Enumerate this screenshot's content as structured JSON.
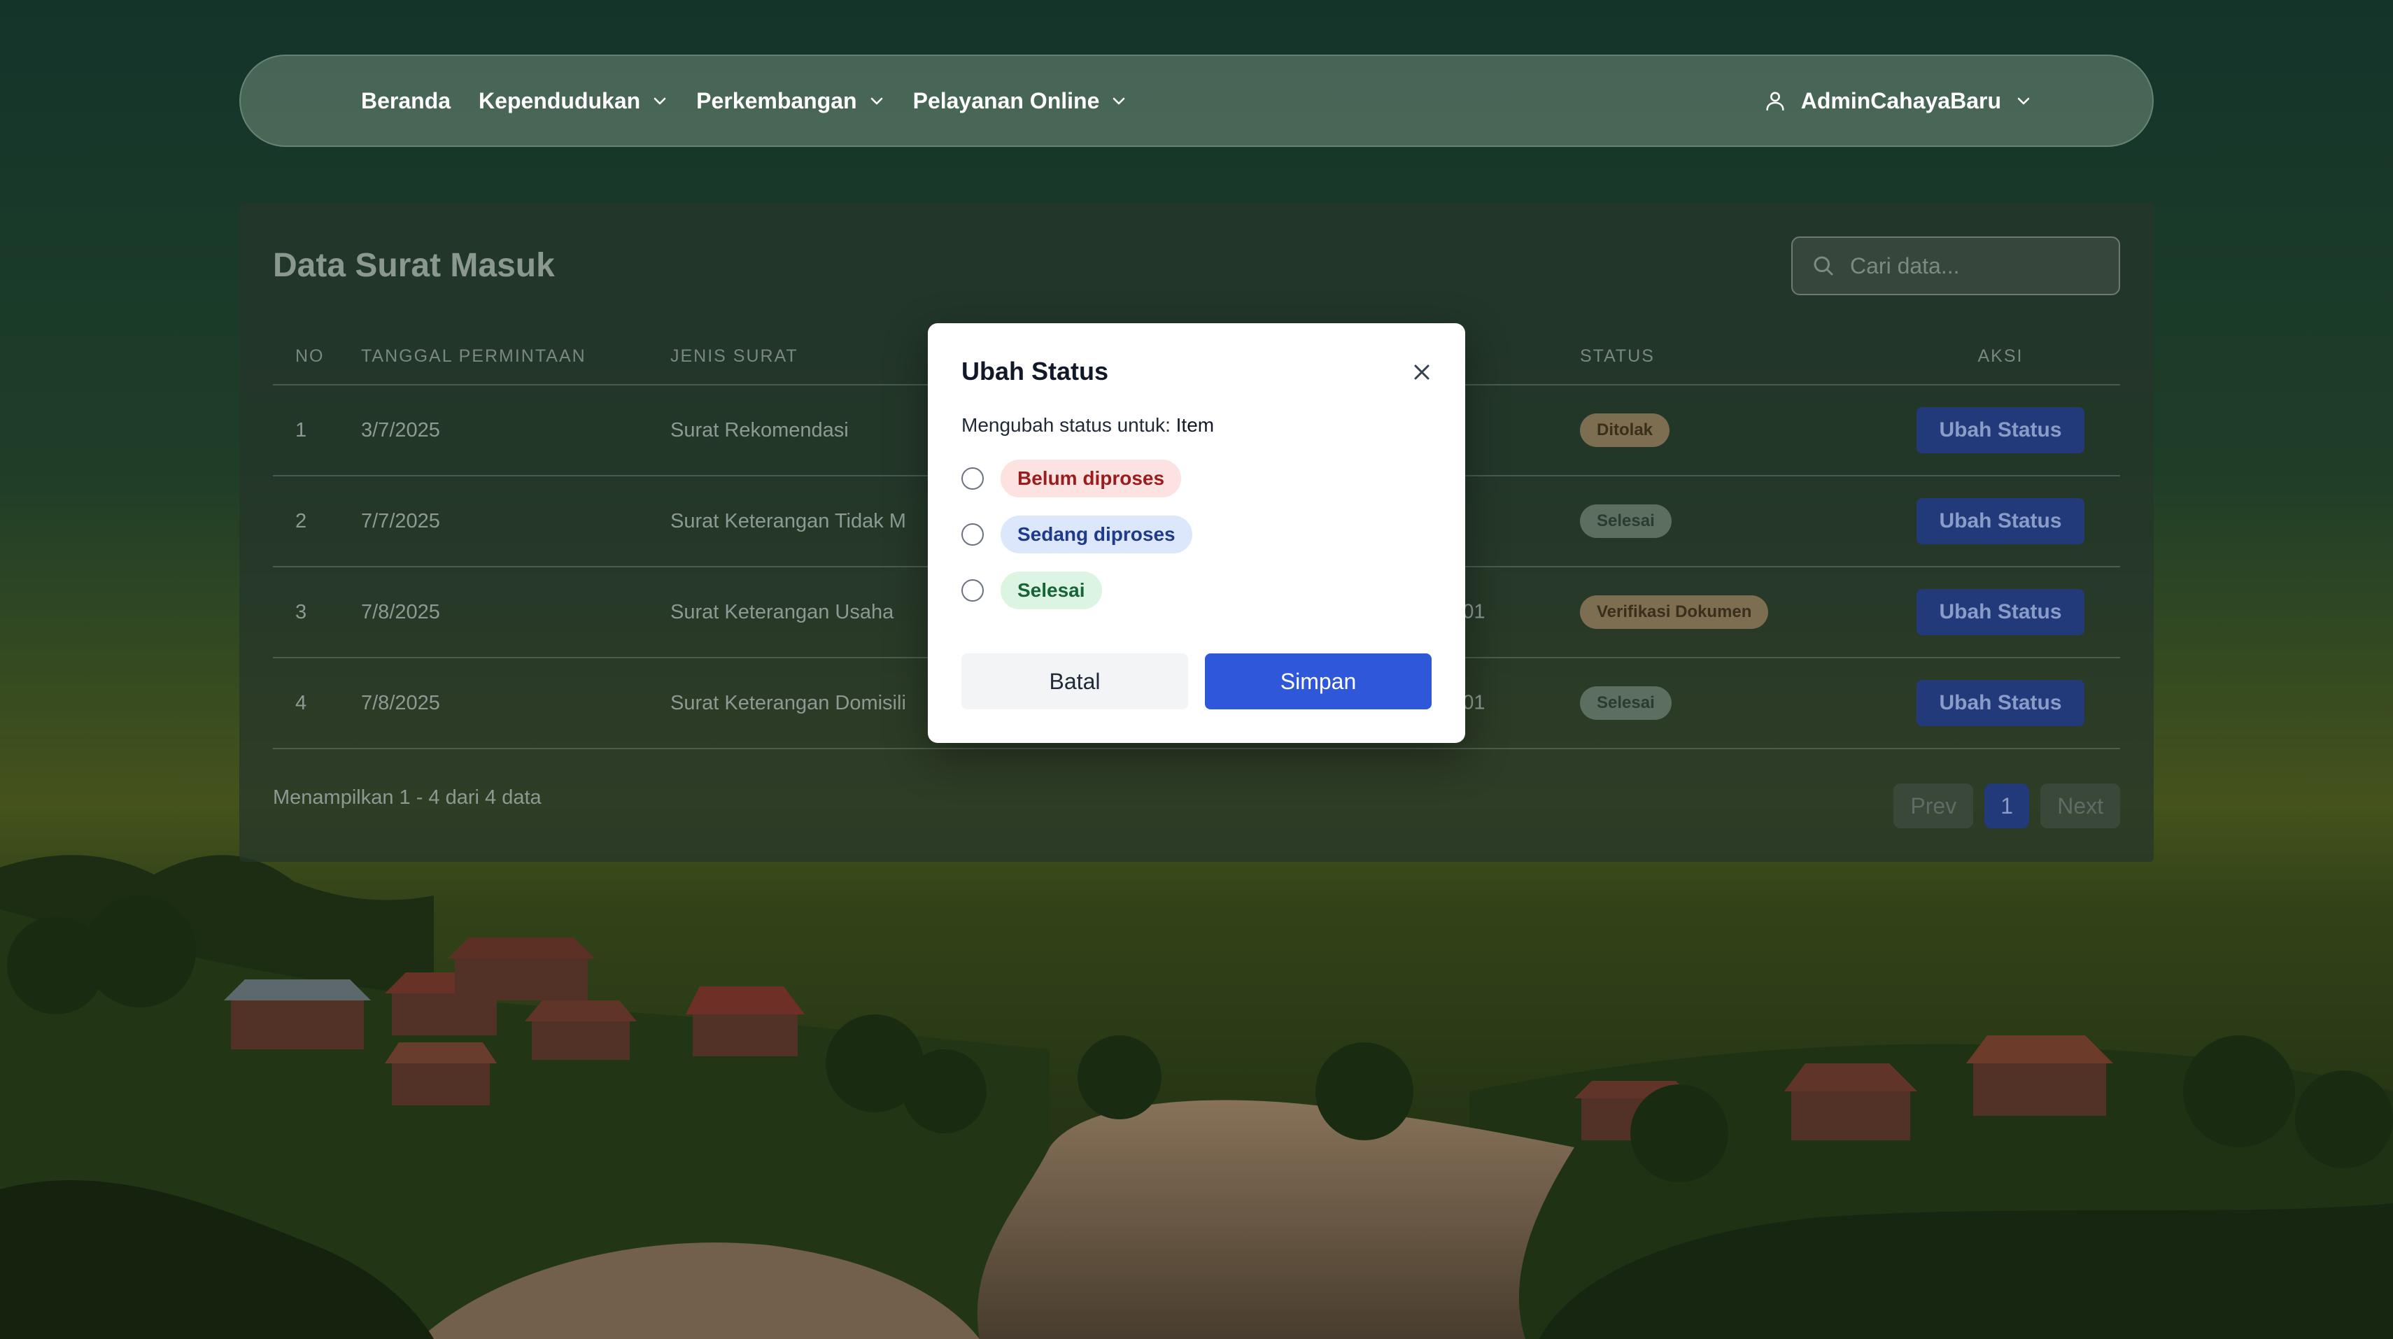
{
  "nav": {
    "items": [
      {
        "label": "Beranda",
        "has_dropdown": false
      },
      {
        "label": "Kependudukan",
        "has_dropdown": true
      },
      {
        "label": "Perkembangan",
        "has_dropdown": true
      },
      {
        "label": "Pelayanan Online",
        "has_dropdown": true
      }
    ],
    "user": "AdminCahayaBaru"
  },
  "page": {
    "title": "Data Surat Masuk",
    "search_placeholder": "Cari data..."
  },
  "table": {
    "headers": [
      "NO",
      "TANGGAL PERMINTAAN",
      "JENIS SURAT",
      "STATUS",
      "AKSI"
    ],
    "rows": [
      {
        "no": "1",
        "date": "3/7/2025",
        "jenis": "Surat Rekomendasi",
        "extra": "",
        "status": "Ditolak",
        "status_kind": "ditolak",
        "action": "Ubah Status"
      },
      {
        "no": "2",
        "date": "7/7/2025",
        "jenis": "Surat Keterangan Tidak M",
        "extra": "",
        "status": "Selesai",
        "status_kind": "selesai",
        "action": "Ubah Status"
      },
      {
        "no": "3",
        "date": "7/8/2025",
        "jenis": "Surat Keterangan Usaha",
        "extra": "0001",
        "status": "Verifikasi Dokumen",
        "status_kind": "verif",
        "action": "Ubah Status"
      },
      {
        "no": "4",
        "date": "7/8/2025",
        "jenis": "Surat Keterangan Domisili",
        "extra": "0001",
        "status": "Selesai",
        "status_kind": "selesai",
        "action": "Ubah Status"
      }
    ],
    "footer_text": "Menampilkan 1 - 4 dari 4 data",
    "pager": {
      "prev": "Prev",
      "current": "1",
      "next": "Next"
    }
  },
  "modal": {
    "title": "Ubah Status",
    "subtitle_prefix": "Mengubah status untuk:",
    "subtitle_item": "Item",
    "options": [
      {
        "label": "Belum diproses",
        "color": "#fde2e2"
      },
      {
        "label": "Sedang diproses",
        "color": "#dde7fb"
      },
      {
        "label": "Selesai",
        "color": "#dcf5e2"
      }
    ],
    "cancel": "Batal",
    "save": "Simpan"
  },
  "colors": {
    "primary": "#2f57d9",
    "nav_text": "#ffffff"
  }
}
